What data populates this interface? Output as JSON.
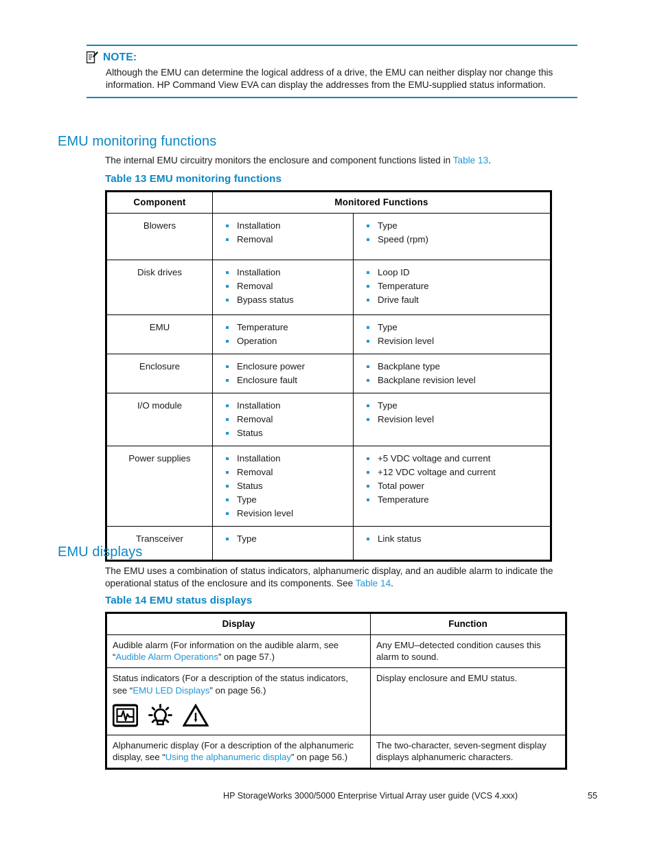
{
  "note": {
    "icon": "note-pencil-icon",
    "label": "NOTE:",
    "text": "Although the EMU can determine the logical address of a drive, the EMU can neither display nor change this information.  HP Command View EVA can display the addresses from the EMU-supplied status information."
  },
  "section1": {
    "heading": "EMU monitoring functions",
    "para_before_link": "The internal EMU circuitry monitors the enclosure and component functions listed in ",
    "para_link": "Table 13",
    "para_after_link": ".",
    "table_title": "Table 13 EMU monitoring functions"
  },
  "table13": {
    "headers": [
      "Component",
      "Monitored  Functions"
    ],
    "rows": [
      {
        "component": "Blowers",
        "col_a": [
          "Installation",
          "Removal"
        ],
        "col_b": [
          "Type",
          "Speed (rpm)"
        ]
      },
      {
        "component": "Disk  drives",
        "col_a": [
          "Installation",
          "Removal",
          "Bypass status"
        ],
        "col_b": [
          "Loop ID",
          "Temperature",
          "Drive fault"
        ]
      },
      {
        "component": "EMU",
        "col_a": [
          "Temperature",
          "Operation"
        ],
        "col_b": [
          "Type",
          "Revision level"
        ]
      },
      {
        "component": "Enclosure",
        "col_a": [
          "Enclosure power",
          "Enclosure fault"
        ],
        "col_b": [
          "Backplane type",
          "Backplane revision level"
        ]
      },
      {
        "component": "I/O module",
        "col_a": [
          "Installation",
          "Removal",
          "Status"
        ],
        "col_b": [
          "Type",
          "Revision level"
        ]
      },
      {
        "component": "Power supplies",
        "col_a": [
          "Installation",
          "Removal",
          "Status",
          "Type",
          "Revision level"
        ],
        "col_b": [
          "+5 VDC voltage and current",
          "+12 VDC voltage and current",
          "Total power",
          "Temperature"
        ]
      },
      {
        "component": "Transceiver",
        "col_a": [
          "Type"
        ],
        "col_b": [
          "Link status"
        ]
      }
    ]
  },
  "section2": {
    "heading": "EMU displays",
    "para_before_link": "The EMU uses a combination of status indicators, alphanumeric display, and an audible alarm to indicate the operational status of the enclosure and its components.  See ",
    "para_link": "Table 14",
    "para_after_link": ".",
    "table_title": "Table 14 EMU status displays"
  },
  "table14": {
    "headers": [
      "Display",
      "Function"
    ],
    "rows": [
      {
        "display_pre": "Audible alarm (For information on the audible alarm, see “",
        "display_link": "Audible Alarm Operations",
        "display_post": "” on page 57.)",
        "function": "Any EMU–detected condition causes this alarm to sound."
      },
      {
        "display_pre": "Status indicators (For a description of the status indicators, see “",
        "display_link": "EMU LED Displays",
        "display_post": "” on page 56.)",
        "icons": [
          "enclosure-status-icon",
          "uid-bulb-icon",
          "fault-warning-icon"
        ],
        "function": "Display enclosure and EMU status."
      },
      {
        "display_pre": "Alphanumeric display (For a description of the alphanumeric display, see “",
        "display_link": "Using the alphanumeric display",
        "display_post": "” on page 56.)",
        "function": "The two-character, seven-segment display displays alphanumeric characters."
      }
    ]
  },
  "footer": {
    "text": "HP StorageWorks 3000/5000 Enterprise Virtual Array user guide (VCS 4.xxx)",
    "page_number": "55"
  },
  "colors": {
    "accent_blue": "#0b87c4",
    "link_blue": "#2196d6",
    "bullet_blue": "#2196d6",
    "text_black": "#1a1a1a"
  }
}
